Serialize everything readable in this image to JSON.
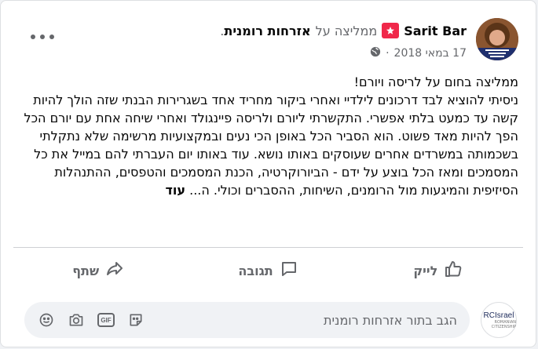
{
  "post": {
    "author": "Sarit Bar",
    "action_text": "ממליצה על",
    "page_name": "אזרחות רומנית",
    "page_name_suffix": ".",
    "date": "17 במאי 2018",
    "separator": "·",
    "avatar_caption": "Sarit Bar"
  },
  "content": {
    "paragraph1": "ממליצה בחום על לריסה ויורם!",
    "paragraph2": "ניסיתי להוציא לבד דרכונים לילדיי ואחרי ביקור מחריד אחד בשגרירות הבנתי שזה הולך להיות קשה עד כמעט בלתי אפשרי. התקשרתי ליורם ולריסה פיינגולד ואחרי שיחה אחת עם יורם הכל הפך להיות מאד פשוט. הוא הסביר הכל באופן הכי נעים ובמקצועיות מרשימה שלא נתקלתי בשכמותה במשרדים אחרים שעוסקים באותו נושא. עוד באותו יום העברתי להם במייל את כל המסמכים ומאז הכל בוצע על ידם - הביורוקרטיה, הכנת המסמכים והטפסים, ההתנהלות הסיזיפית והמיגעות מול הרומנים, השיחות, ההסברים וכולי. ה...",
    "see_more": "עוד"
  },
  "actions": {
    "like": "לייק",
    "comment": "תגובה",
    "share": "שתף"
  },
  "comment_box": {
    "placeholder": "הגב בתור אזרחות רומנית",
    "avatar_logo": "RCIsrael",
    "avatar_sub": "ROMANIAN CITIZENSHIP",
    "gif_label": "GIF"
  },
  "colors": {
    "accent_red": "#f0284a",
    "text_primary": "#050505",
    "text_secondary": "#65676b"
  },
  "icons": {
    "globe": "globe-icon",
    "recommend": "recommend-star-icon",
    "more": "more-horizontal-icon",
    "like": "thumbs-up-icon",
    "comment": "comment-bubble-icon",
    "share": "share-arrow-icon",
    "emoji": "emoji-icon",
    "camera": "camera-icon",
    "gif": "gif-icon",
    "sticker": "sticker-icon"
  }
}
